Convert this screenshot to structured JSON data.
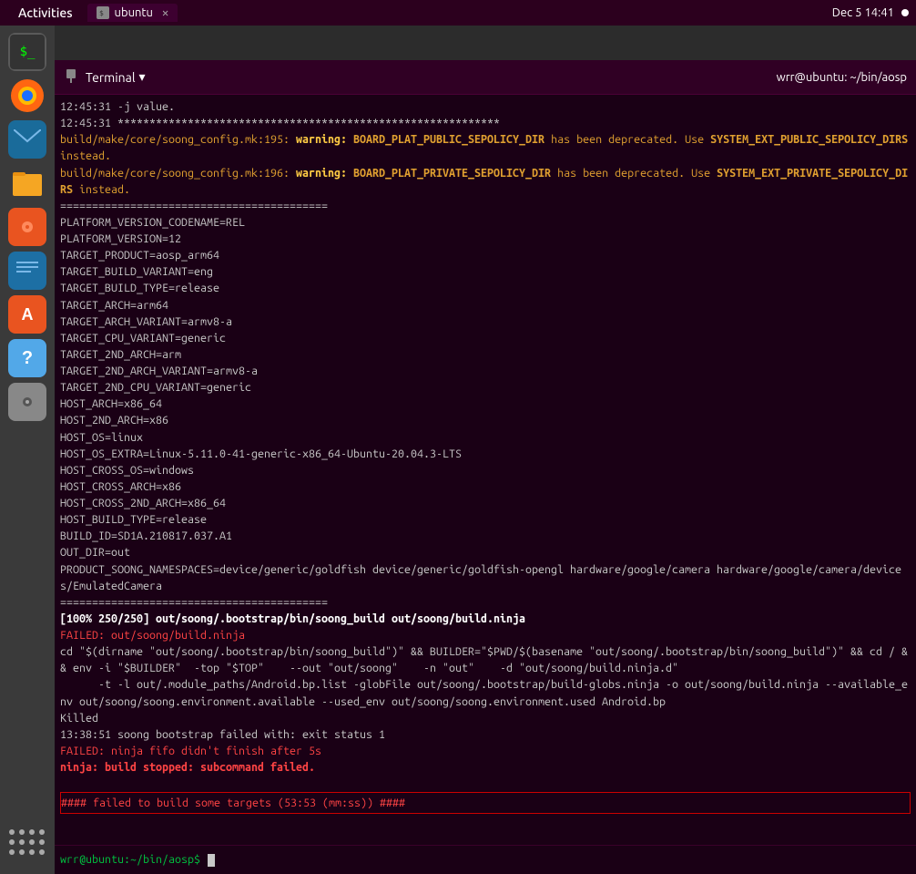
{
  "system_bar": {
    "activities_label": "Activities",
    "window_tab_label": "ubuntu",
    "terminal_menu_label": "Terminal",
    "datetime": "Dec 5  14:41",
    "title_right": "wrr@ubuntu: ~/bin/aosp"
  },
  "sidebar": {
    "icons": [
      {
        "name": "terminal",
        "symbol": ">_",
        "label": "Terminal"
      },
      {
        "name": "firefox",
        "symbol": "🦊",
        "label": "Firefox"
      },
      {
        "name": "mail",
        "symbol": "✉",
        "label": "Mail"
      },
      {
        "name": "files",
        "symbol": "📁",
        "label": "Files"
      },
      {
        "name": "music",
        "symbol": "🎵",
        "label": "Music"
      },
      {
        "name": "writer",
        "symbol": "📄",
        "label": "Writer"
      },
      {
        "name": "appstore",
        "symbol": "A",
        "label": "App Store"
      },
      {
        "name": "help",
        "symbol": "?",
        "label": "Help"
      },
      {
        "name": "dvd",
        "symbol": "💿",
        "label": "DVD"
      },
      {
        "name": "apps",
        "symbol": "⋮⋮",
        "label": "Apps"
      }
    ]
  },
  "terminal": {
    "pin_icon": "📌",
    "title": "wrr@ubuntu: ~/bin/aosp",
    "prompt": "wrr@ubuntu:~/bin/aosp$",
    "lines": [
      {
        "text": "12:45:31 -j value.",
        "class": "term-white"
      },
      {
        "text": "12:45:31 ************************************************************",
        "class": "term-white"
      },
      {
        "text": "build/make/core/soong_config.mk:195: warning: BOARD_PLAT_PUBLIC_SEPOLICY_DIR has been deprecated. Use SYSTEM_EXT_PUBLIC_SEPOLICY_DIRS instead.",
        "class": "term-warning"
      },
      {
        "text": "build/make/core/soong_config.mk:196: warning: BOARD_PLAT_PRIVATE_SEPOLICY_DIR has been deprecated. Use SYSTEM_EXT_PRIVATE_SEPOLICY_DIRS instead.",
        "class": "term-warning"
      },
      {
        "text": "==========================================",
        "class": "term-separator"
      },
      {
        "text": "PLATFORM_VERSION_CODENAME=REL",
        "class": "term-white"
      },
      {
        "text": "PLATFORM_VERSION=12",
        "class": "term-white"
      },
      {
        "text": "TARGET_PRODUCT=aosp_arm64",
        "class": "term-white"
      },
      {
        "text": "TARGET_BUILD_VARIANT=eng",
        "class": "term-white"
      },
      {
        "text": "TARGET_BUILD_TYPE=release",
        "class": "term-white"
      },
      {
        "text": "TARGET_ARCH=arm64",
        "class": "term-white"
      },
      {
        "text": "TARGET_ARCH_VARIANT=armv8-a",
        "class": "term-white"
      },
      {
        "text": "TARGET_CPU_VARIANT=generic",
        "class": "term-white"
      },
      {
        "text": "TARGET_2ND_ARCH=arm",
        "class": "term-white"
      },
      {
        "text": "TARGET_2ND_ARCH_VARIANT=armv8-a",
        "class": "term-white"
      },
      {
        "text": "TARGET_2ND_CPU_VARIANT=generic",
        "class": "term-white"
      },
      {
        "text": "HOST_ARCH=x86_64",
        "class": "term-white"
      },
      {
        "text": "HOST_2ND_ARCH=x86",
        "class": "term-white"
      },
      {
        "text": "HOST_OS=linux",
        "class": "term-white"
      },
      {
        "text": "HOST_OS_EXTRA=Linux-5.11.0-41-generic-x86_64-Ubuntu-20.04.3-LTS",
        "class": "term-white"
      },
      {
        "text": "HOST_CROSS_OS=windows",
        "class": "term-white"
      },
      {
        "text": "HOST_CROSS_ARCH=x86",
        "class": "term-white"
      },
      {
        "text": "HOST_CROSS_2ND_ARCH=x86_64",
        "class": "term-white"
      },
      {
        "text": "HOST_BUILD_TYPE=release",
        "class": "term-white"
      },
      {
        "text": "BUILD_ID=SD1A.210817.037.A1",
        "class": "term-white"
      },
      {
        "text": "OUT_DIR=out",
        "class": "term-white"
      },
      {
        "text": "PRODUCT_SOONG_NAMESPACES=device/generic/goldfish device/generic/goldfish-opengl hardware/google/camera hardware/google/camera/devices/EmulatedCamera",
        "class": "term-white"
      },
      {
        "text": "==========================================",
        "class": "term-separator"
      },
      {
        "text": "[100% 250/250] out/soong/.bootstrap/bin/soong_build out/soong/build.ninja",
        "class": "term-bold-white"
      },
      {
        "text": "FAILED: out/soong/build.ninja",
        "class": "term-red"
      },
      {
        "text": "cd \"$(dirname \"out/soong/.bootstrap/bin/soong_build\")\" && BUILDER=\"$PWD/$(basename \"out/soong/.bootstrap/bin/soong_build\")\" && cd / && env -i \"$BUILDER\"  -top \"$TOP\"  --out \"out/soong\"  -n \"out\"  -d \"out/soong/build.ninja.d\"  -t -l out/.module_paths/Android.bp.list -globFile out/soong/.bootstrap/build-globs.ninja -o out/soong/build.ninja --available_env out/soong/soong.environment.available --used_env out/soong/soong.environment.used Android.bp",
        "class": "term-white"
      },
      {
        "text": "Killed",
        "class": "term-white"
      },
      {
        "text": "13:38:51 soong bootstrap failed with: exit status 1",
        "class": "term-white"
      },
      {
        "text": "FAILED: ninja fifo didn't finish after 5s",
        "class": "term-red"
      },
      {
        "text": "ninja: build stopped: subcommand failed.",
        "class": "term-bold-red"
      },
      {
        "text": "",
        "class": "term-white"
      },
      {
        "text": "#### failed to build some targets (53:53 (mm:ss)) ####",
        "class": "term-red",
        "boxed": true
      }
    ]
  }
}
